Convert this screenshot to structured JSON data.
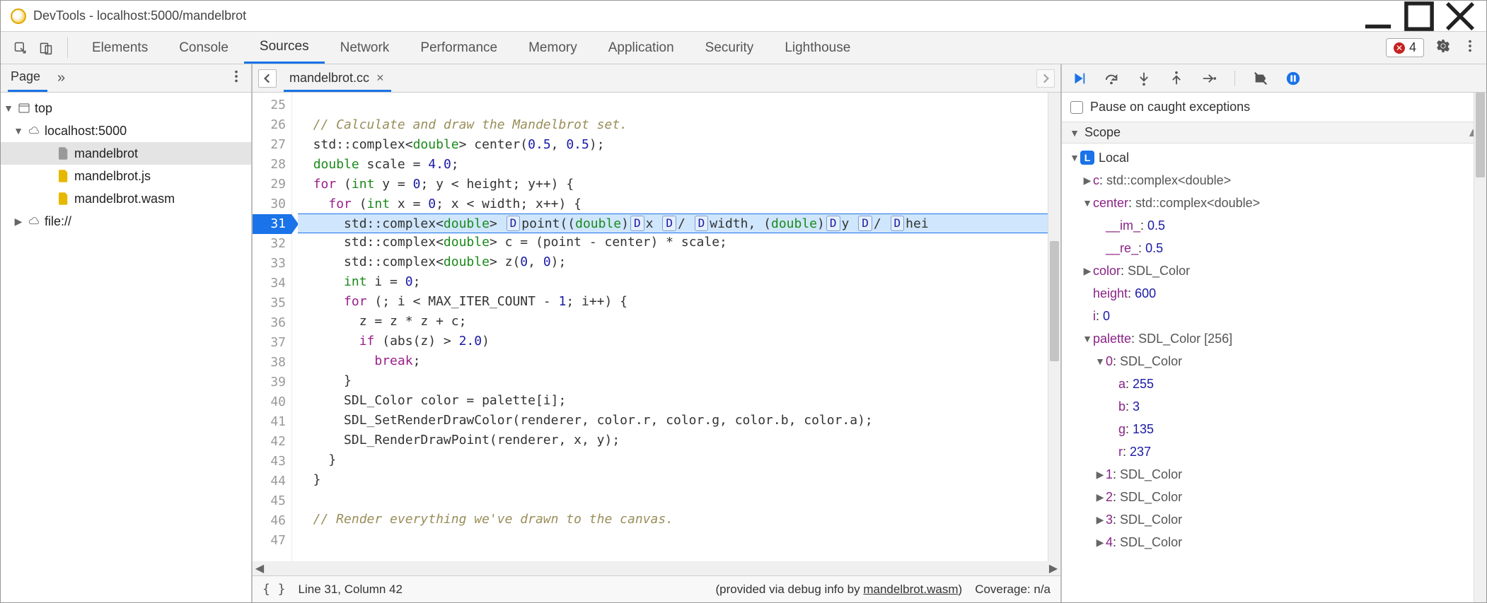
{
  "window": {
    "title": "DevTools - localhost:5000/mandelbrot"
  },
  "toolbar": {
    "tabs": [
      "Elements",
      "Console",
      "Sources",
      "Network",
      "Performance",
      "Memory",
      "Application",
      "Security",
      "Lighthouse"
    ],
    "active_tab": "Sources",
    "error_count": "4"
  },
  "sidebar": {
    "tab": "Page",
    "tree": {
      "root": "top",
      "host": "localhost:5000",
      "files": [
        "mandelbrot",
        "mandelbrot.js",
        "mandelbrot.wasm"
      ],
      "extra": "file://"
    }
  },
  "editor": {
    "tab_label": "mandelbrot.cc",
    "first_line_no": 25,
    "current_line_no": 31,
    "lines": [
      {
        "n": 25,
        "raw": ""
      },
      {
        "n": 26,
        "raw": "  // Calculate and draw the Mandelbrot set."
      },
      {
        "n": 27,
        "raw": "  std::complex<double> center(0.5, 0.5);"
      },
      {
        "n": 28,
        "raw": "  double scale = 4.0;"
      },
      {
        "n": 29,
        "raw": "  for (int y = 0; y < height; y++) {"
      },
      {
        "n": 30,
        "raw": "    for (int x = 0; x < width; x++) {"
      },
      {
        "n": 31,
        "raw": "      std::complex<double> point((double)x / width, (double)y / hei"
      },
      {
        "n": 32,
        "raw": "      std::complex<double> c = (point - center) * scale;"
      },
      {
        "n": 33,
        "raw": "      std::complex<double> z(0, 0);"
      },
      {
        "n": 34,
        "raw": "      int i = 0;"
      },
      {
        "n": 35,
        "raw": "      for (; i < MAX_ITER_COUNT - 1; i++) {"
      },
      {
        "n": 36,
        "raw": "        z = z * z + c;"
      },
      {
        "n": 37,
        "raw": "        if (abs(z) > 2.0)"
      },
      {
        "n": 38,
        "raw": "          break;"
      },
      {
        "n": 39,
        "raw": "      }"
      },
      {
        "n": 40,
        "raw": "      SDL_Color color = palette[i];"
      },
      {
        "n": 41,
        "raw": "      SDL_SetRenderDrawColor(renderer, color.r, color.g, color.b, color.a);"
      },
      {
        "n": 42,
        "raw": "      SDL_RenderDrawPoint(renderer, x, y);"
      },
      {
        "n": 43,
        "raw": "    }"
      },
      {
        "n": 44,
        "raw": "  }"
      },
      {
        "n": 45,
        "raw": ""
      },
      {
        "n": 46,
        "raw": "  // Render everything we've drawn to the canvas."
      },
      {
        "n": 47,
        "raw": ""
      }
    ],
    "debug_chips_line31": [
      "D",
      "D",
      "D",
      "D",
      "D",
      "D",
      "D"
    ],
    "status": {
      "position": "Line 31, Column 42",
      "provided_prefix": "(provided via debug info by ",
      "provided_link": "mandelbrot.wasm",
      "provided_suffix": ")",
      "coverage": "Coverage: n/a"
    }
  },
  "debug": {
    "pause_caught_label": "Pause on caught exceptions",
    "scope_label": "Scope",
    "local_label": "Local",
    "vars": {
      "c": {
        "type": "std::complex<double>"
      },
      "center": {
        "type": "std::complex<double>",
        "im": "0.5",
        "re": "0.5"
      },
      "color": {
        "type": "SDL_Color"
      },
      "height": "600",
      "i": "0",
      "palette": {
        "type": "SDL_Color [256]"
      },
      "p0": {
        "label": "0",
        "type": "SDL_Color",
        "a": "255",
        "b": "3",
        "g": "135",
        "r": "237"
      },
      "p1": {
        "label": "1",
        "type": "SDL_Color"
      },
      "p2": {
        "label": "2",
        "type": "SDL_Color"
      },
      "p3": {
        "label": "3",
        "type": "SDL_Color"
      },
      "p4": {
        "label": "4",
        "type": "SDL_Color"
      }
    }
  }
}
